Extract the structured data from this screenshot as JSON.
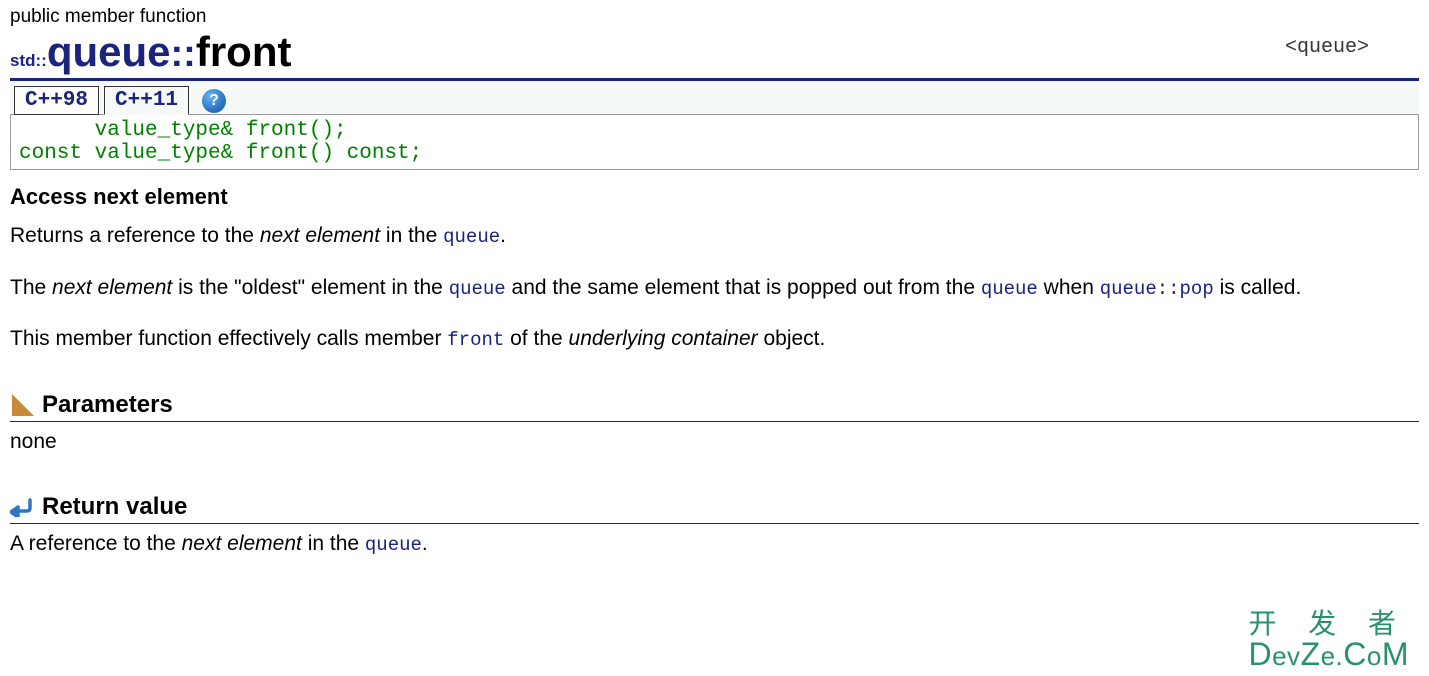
{
  "header_label": "public member function",
  "top_right_tag": "<queue>",
  "scope_prefix": "std::",
  "class_name": "queue",
  "scope_sep": "::",
  "func_name": "front",
  "tabs": {
    "cpp98": "C++98",
    "cpp11": "C++11"
  },
  "help_symbol": "?",
  "signature": "      value_type& front();\nconst value_type& front() const;",
  "brief_title": "Access next element",
  "p1": {
    "t1": "Returns a reference to the ",
    "it1": "next element",
    "t2": " in the ",
    "link1": "queue",
    "t3": "."
  },
  "p2": {
    "t1": "The ",
    "it1": "next element",
    "t2": " is the \"oldest\" element in the ",
    "link1": "queue",
    "t3": " and the same element that is popped out from the ",
    "link2": "queue",
    "t4": " when ",
    "link3": "queue::pop",
    "t5": " is called."
  },
  "p3": {
    "t1": "This member function effectively calls member ",
    "link1": "front",
    "t2": " of the ",
    "it1": "underlying container",
    "t3": " object."
  },
  "sections": {
    "parameters_title": "Parameters",
    "parameters_body": "none",
    "return_title": "Return value",
    "return_body": {
      "t1": "A reference to the ",
      "it1": "next element",
      "t2": " in the ",
      "link1": "queue",
      "t3": "."
    }
  },
  "watermark": {
    "line1": "开 发 者",
    "line2a": "D",
    "line2b": "ev",
    "line2c": "Z",
    "line2d": "e.",
    "line2e": "C",
    "line2f": "o",
    "line2g": "M"
  }
}
